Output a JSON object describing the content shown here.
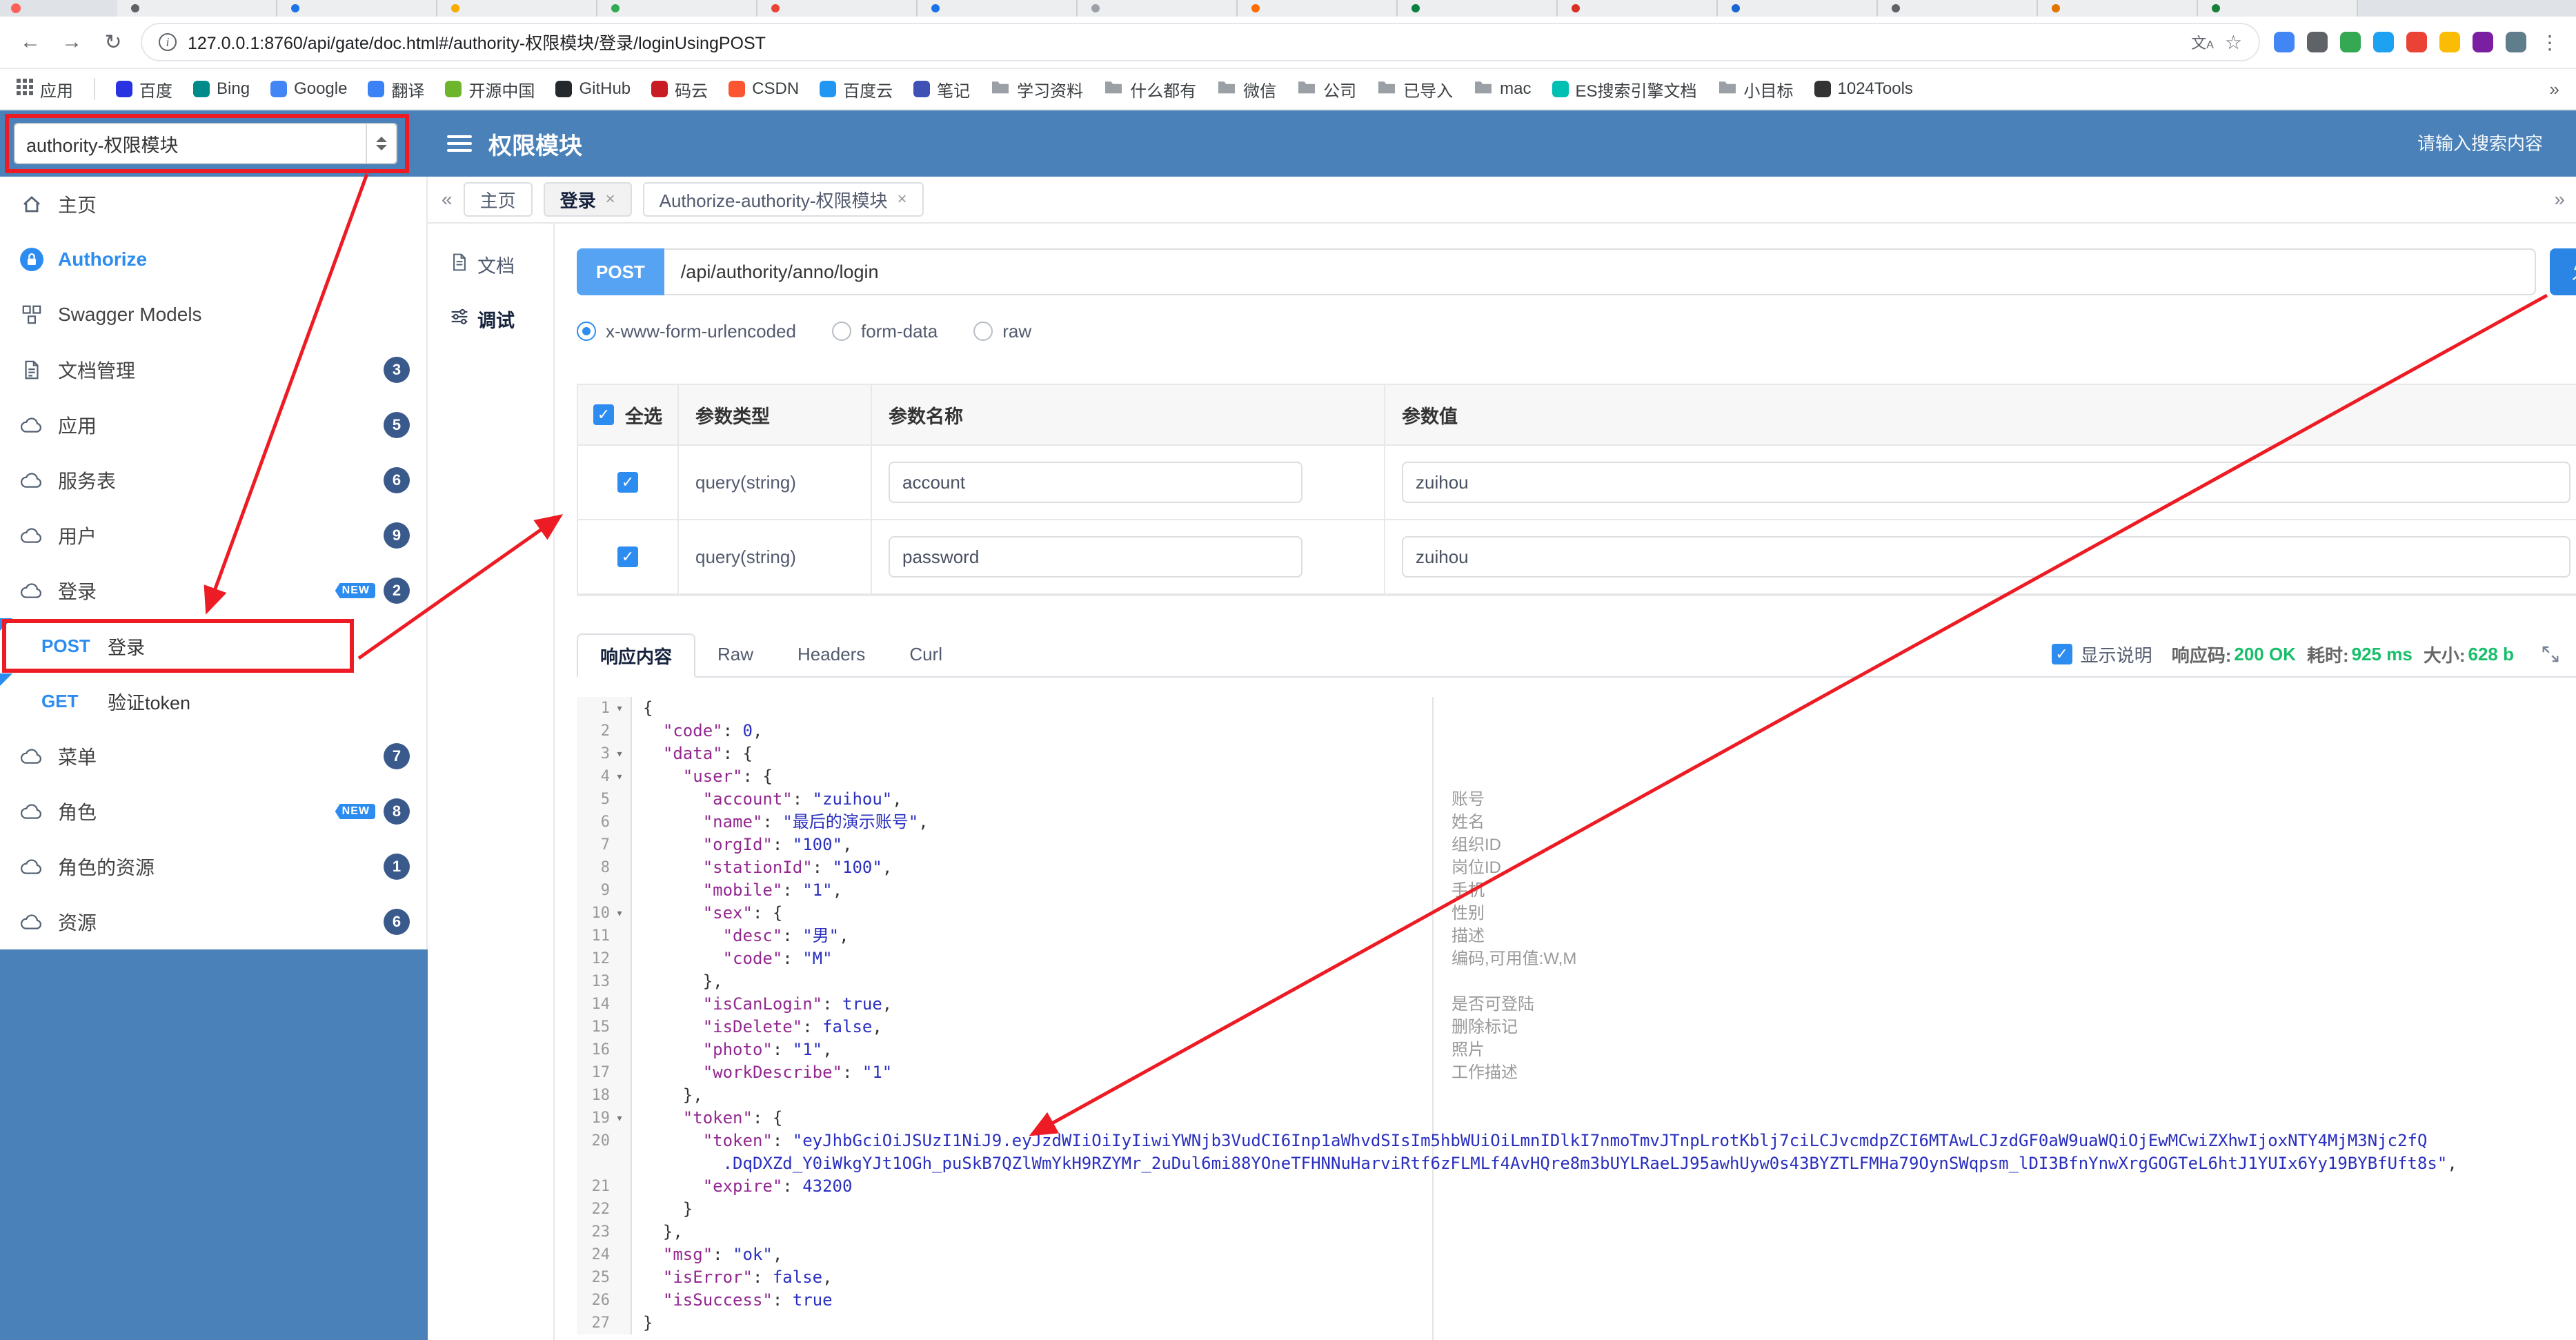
{
  "colors": {
    "header-blue": "#4a81b8",
    "accent-blue": "#2d8cf0",
    "method-blue": "#57a3f3",
    "success-green": "#19be6b",
    "annotation-red": "#ed1c24",
    "badge-navy": "#3a5a8c"
  },
  "browser": {
    "close_dot_color": "#ff5f57",
    "tab_favicons": [
      "#5f6368",
      "#1a73e8",
      "#f9ab00",
      "#34a853",
      "#ea4335",
      "#1a73e8",
      "#9aa0a6",
      "#ff6d00",
      "#0b8043",
      "#d93025",
      "#1967d2",
      "#5f6368",
      "#e37400",
      "#188038"
    ],
    "nav": {
      "back": "←",
      "forward": "→",
      "refresh": "↻"
    },
    "url": "127.0.0.1:8760/api/gate/doc.html#/authority-权限模块/登录/loginUsingPOST",
    "menu_dots": "⋮",
    "extensions": [
      "#4285f4",
      "#5f6368",
      "#34a853",
      "#1da1f2",
      "#ea4335",
      "#fbbc05",
      "#7b1fa2",
      "#607d8b"
    ],
    "bookmarks_overflow": "»",
    "bookmarks": [
      {
        "label": "应用",
        "icon": "grid"
      },
      {
        "label": "百度",
        "icon": "dot",
        "color": "#2932e1"
      },
      {
        "label": "Bing",
        "icon": "dot",
        "color": "#008b8b"
      },
      {
        "label": "Google",
        "icon": "dot",
        "color": "#4285f4"
      },
      {
        "label": "翻译",
        "icon": "dot",
        "color": "#3b82f6"
      },
      {
        "label": "开源中国",
        "icon": "dot",
        "color": "#6cb52d"
      },
      {
        "label": "GitHub",
        "icon": "dot",
        "color": "#24292e"
      },
      {
        "label": "码云",
        "icon": "dot",
        "color": "#c71d23"
      },
      {
        "label": "CSDN",
        "icon": "dot",
        "color": "#fc5531"
      },
      {
        "label": "百度云",
        "icon": "dot",
        "color": "#2196f3"
      },
      {
        "label": "笔记",
        "icon": "dot",
        "color": "#3f51b5"
      },
      {
        "label": "学习资料",
        "icon": "folder"
      },
      {
        "label": "什么都有",
        "icon": "folder"
      },
      {
        "label": "微信",
        "icon": "folder"
      },
      {
        "label": "公司",
        "icon": "folder"
      },
      {
        "label": "已导入",
        "icon": "folder"
      },
      {
        "label": "mac",
        "icon": "folder"
      },
      {
        "label": "ES搜索引擎文档",
        "icon": "dot",
        "color": "#00bfb3"
      },
      {
        "label": "小目标",
        "icon": "folder"
      },
      {
        "label": "1024Tools",
        "icon": "dot",
        "color": "#333333"
      }
    ]
  },
  "header": {
    "module_select": "authority-权限模块",
    "title": "权限模块",
    "search_placeholder": "请输入搜索内容"
  },
  "sidebar": {
    "items": [
      {
        "label": "主页",
        "icon": "home"
      },
      {
        "label": "Authorize",
        "icon": "lock",
        "accent": true
      },
      {
        "label": "Swagger Models",
        "icon": "models"
      },
      {
        "label": "文档管理",
        "icon": "docmgr",
        "badge": "3"
      },
      {
        "label": "应用",
        "icon": "cloud",
        "badge": "5"
      },
      {
        "label": "服务表",
        "icon": "cloud",
        "badge": "6"
      },
      {
        "label": "用户",
        "icon": "cloud",
        "badge": "9"
      },
      {
        "label": "登录",
        "icon": "cloud",
        "badge": "2",
        "new_tag": "NEW"
      },
      {
        "api": true,
        "method": "POST",
        "label": "登录"
      },
      {
        "api": true,
        "method": "GET",
        "label": "验证token"
      },
      {
        "label": "菜单",
        "icon": "cloud",
        "badge": "7"
      },
      {
        "label": "角色",
        "icon": "cloud",
        "badge": "8",
        "new_tag": "NEW"
      },
      {
        "label": "角色的资源",
        "icon": "cloud",
        "badge": "1"
      },
      {
        "label": "资源",
        "icon": "cloud",
        "badge": "6"
      }
    ]
  },
  "page_tabs": {
    "left_chevron": "«",
    "right_chevron": "»",
    "close_glyph": "×",
    "tabs": [
      {
        "label": "主页",
        "closable": false,
        "active": false
      },
      {
        "label": "登录",
        "closable": true,
        "active": true
      },
      {
        "label": "Authorize-authority-权限模块",
        "closable": true,
        "active": false
      }
    ]
  },
  "doc_nav": {
    "items": [
      {
        "label": "文档",
        "icon": "filetext",
        "active": false
      },
      {
        "label": "调试",
        "icon": "sliders",
        "active": true
      }
    ]
  },
  "request": {
    "method": "POST",
    "path": "/api/authority/anno/login",
    "send_label": "发送",
    "content_types": [
      {
        "label": "x-www-form-urlencoded",
        "selected": true
      },
      {
        "label": "form-data",
        "selected": false
      },
      {
        "label": "raw",
        "selected": false
      }
    ],
    "table": {
      "headers": [
        "全选",
        "参数类型",
        "参数名称",
        "参数值"
      ],
      "rows": [
        {
          "checked": true,
          "type": "query(string)",
          "name": "account",
          "value": "zuihou"
        },
        {
          "checked": true,
          "type": "query(string)",
          "name": "password",
          "value": "zuihou"
        }
      ]
    }
  },
  "response": {
    "tabs": [
      {
        "label": "响应内容",
        "active": true
      },
      {
        "label": "Raw",
        "active": false
      },
      {
        "label": "Headers",
        "active": false
      },
      {
        "label": "Curl",
        "active": false
      }
    ],
    "show_desc_label": "显示说明",
    "show_desc_checked": true,
    "meta": [
      {
        "label": "响应码:",
        "value": "200 OK"
      },
      {
        "label": "耗时:",
        "value": "925 ms"
      },
      {
        "label": "大小:",
        "value": "628 b"
      }
    ],
    "code_lines": [
      {
        "n": "1",
        "fold": true,
        "seg": [
          [
            "pl",
            "{"
          ]
        ]
      },
      {
        "n": "2",
        "seg": [
          [
            "pl",
            "  "
          ],
          [
            "ky",
            "\"code\""
          ],
          [
            "pl",
            ": "
          ],
          [
            "nu",
            "0"
          ],
          [
            "pl",
            ","
          ]
        ]
      },
      {
        "n": "3",
        "fold": true,
        "seg": [
          [
            "pl",
            "  "
          ],
          [
            "ky",
            "\"data\""
          ],
          [
            "pl",
            ": {"
          ]
        ]
      },
      {
        "n": "4",
        "fold": true,
        "seg": [
          [
            "pl",
            "    "
          ],
          [
            "ky",
            "\"user\""
          ],
          [
            "pl",
            ": {"
          ]
        ]
      },
      {
        "n": "5",
        "c": "账号",
        "seg": [
          [
            "pl",
            "      "
          ],
          [
            "ky",
            "\"account\""
          ],
          [
            "pl",
            ": "
          ],
          [
            "st",
            "\"zuihou\""
          ],
          [
            "pl",
            ","
          ]
        ]
      },
      {
        "n": "6",
        "c": "姓名",
        "seg": [
          [
            "pl",
            "      "
          ],
          [
            "ky",
            "\"name\""
          ],
          [
            "pl",
            ": "
          ],
          [
            "st",
            "\"最后的演示账号\""
          ],
          [
            "pl",
            ","
          ]
        ]
      },
      {
        "n": "7",
        "c": "组织ID",
        "seg": [
          [
            "pl",
            "      "
          ],
          [
            "ky",
            "\"orgId\""
          ],
          [
            "pl",
            ": "
          ],
          [
            "st",
            "\"100\""
          ],
          [
            "pl",
            ","
          ]
        ]
      },
      {
        "n": "8",
        "c": "岗位ID",
        "seg": [
          [
            "pl",
            "      "
          ],
          [
            "ky",
            "\"stationId\""
          ],
          [
            "pl",
            ": "
          ],
          [
            "st",
            "\"100\""
          ],
          [
            "pl",
            ","
          ]
        ]
      },
      {
        "n": "9",
        "c": "手机",
        "seg": [
          [
            "pl",
            "      "
          ],
          [
            "ky",
            "\"mobile\""
          ],
          [
            "pl",
            ": "
          ],
          [
            "st",
            "\"1\""
          ],
          [
            "pl",
            ","
          ]
        ]
      },
      {
        "n": "10",
        "fold": true,
        "c": "性别",
        "seg": [
          [
            "pl",
            "      "
          ],
          [
            "ky",
            "\"sex\""
          ],
          [
            "pl",
            ": {"
          ]
        ]
      },
      {
        "n": "11",
        "c": "描述",
        "seg": [
          [
            "pl",
            "        "
          ],
          [
            "ky",
            "\"desc\""
          ],
          [
            "pl",
            ": "
          ],
          [
            "st",
            "\"男\""
          ],
          [
            "pl",
            ","
          ]
        ]
      },
      {
        "n": "12",
        "c": "编码,可用值:W,M",
        "seg": [
          [
            "pl",
            "        "
          ],
          [
            "ky",
            "\"code\""
          ],
          [
            "pl",
            ": "
          ],
          [
            "st",
            "\"M\""
          ]
        ]
      },
      {
        "n": "13",
        "seg": [
          [
            "pl",
            "      },"
          ]
        ]
      },
      {
        "n": "14",
        "c": "是否可登陆",
        "seg": [
          [
            "pl",
            "      "
          ],
          [
            "ky",
            "\"isCanLogin\""
          ],
          [
            "pl",
            ": "
          ],
          [
            "bo",
            "true"
          ],
          [
            "pl",
            ","
          ]
        ]
      },
      {
        "n": "15",
        "c": "删除标记",
        "seg": [
          [
            "pl",
            "      "
          ],
          [
            "ky",
            "\"isDelete\""
          ],
          [
            "pl",
            ": "
          ],
          [
            "bo",
            "false"
          ],
          [
            "pl",
            ","
          ]
        ]
      },
      {
        "n": "16",
        "c": "照片",
        "seg": [
          [
            "pl",
            "      "
          ],
          [
            "ky",
            "\"photo\""
          ],
          [
            "pl",
            ": "
          ],
          [
            "st",
            "\"1\""
          ],
          [
            "pl",
            ","
          ]
        ]
      },
      {
        "n": "17",
        "c": "工作描述",
        "seg": [
          [
            "pl",
            "      "
          ],
          [
            "ky",
            "\"workDescribe\""
          ],
          [
            "pl",
            ": "
          ],
          [
            "st",
            "\"1\""
          ]
        ]
      },
      {
        "n": "18",
        "seg": [
          [
            "pl",
            "    },"
          ]
        ]
      },
      {
        "n": "19",
        "fold": true,
        "seg": [
          [
            "pl",
            "    "
          ],
          [
            "ky",
            "\"token\""
          ],
          [
            "pl",
            ": {"
          ]
        ]
      },
      {
        "n": "20",
        "seg": [
          [
            "pl",
            "      "
          ],
          [
            "ky",
            "\"token\""
          ],
          [
            "pl",
            ": "
          ],
          [
            "st",
            "\"eyJhbGciOiJSUzI1NiJ9.eyJzdWIiOiIyIiwiYWNjb3VudCI6Inp1aWhvdSIsIm5hbWUiOiLmnIDlkI7nmoTmvJTnpLrotKblj7ciLCJvcmdpZCI6MTAwLCJzdGF0aW9uaWQiOjEwMCwiZXhwIjoxNTY4MjM3Njc2fQ"
          ]
        ]
      },
      {
        "n": "",
        "seg": [
          [
            "pl",
            "        "
          ],
          [
            "st",
            ".DqDXZd_Y0iWkgYJt1OGh_puSkB7QZlWmYkH9RZYMr_2uDul6mi88YOneTFHNNuHarviRtf6zFLMLf4AvHQre8m3bUYLRaeLJ95awhUyw0s43BYZTLFMHa79OynSWqpsm_lDI3BfnYnwXrgGOGTeL6htJ1YUIx6Yy19BYBfUft8s\""
          ],
          [
            "pl",
            ","
          ]
        ]
      },
      {
        "n": "21",
        "seg": [
          [
            "pl",
            "      "
          ],
          [
            "ky",
            "\"expire\""
          ],
          [
            "pl",
            ": "
          ],
          [
            "nu",
            "43200"
          ]
        ]
      },
      {
        "n": "22",
        "seg": [
          [
            "pl",
            "    }"
          ]
        ]
      },
      {
        "n": "23",
        "seg": [
          [
            "pl",
            "  },"
          ]
        ]
      },
      {
        "n": "24",
        "seg": [
          [
            "pl",
            "  "
          ],
          [
            "ky",
            "\"msg\""
          ],
          [
            "pl",
            ": "
          ],
          [
            "st",
            "\"ok\""
          ],
          [
            "pl",
            ","
          ]
        ]
      },
      {
        "n": "25",
        "seg": [
          [
            "pl",
            "  "
          ],
          [
            "ky",
            "\"isError\""
          ],
          [
            "pl",
            ": "
          ],
          [
            "bo",
            "false"
          ],
          [
            "pl",
            ","
          ]
        ]
      },
      {
        "n": "26",
        "seg": [
          [
            "pl",
            "  "
          ],
          [
            "ky",
            "\"isSuccess\""
          ],
          [
            "pl",
            ": "
          ],
          [
            "bo",
            "true"
          ]
        ]
      },
      {
        "n": "27",
        "seg": [
          [
            "pl",
            "}"
          ]
        ]
      }
    ]
  }
}
